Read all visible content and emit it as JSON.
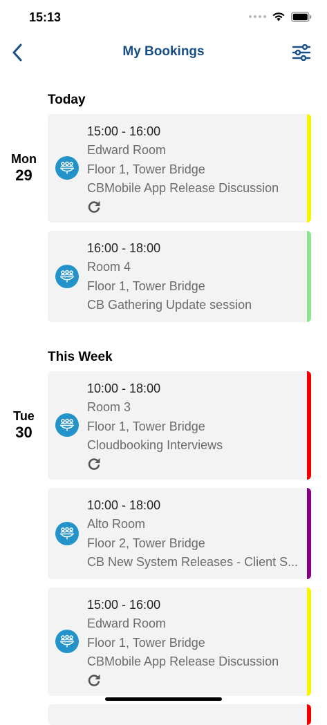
{
  "status": {
    "time": "15:13"
  },
  "nav": {
    "title": "My Bookings"
  },
  "sections": [
    {
      "title": "Today",
      "days": [
        {
          "dow": "Mon",
          "num": "29",
          "bookings": [
            {
              "time": "15:00 - 16:00",
              "room": "Edward Room",
              "location": "Floor 1, Tower Bridge",
              "title": "CBMobile App Release Discussion",
              "recurring": true,
              "color": "#f5f500"
            },
            {
              "time": "16:00 - 18:00",
              "room": "Room 4",
              "location": "Floor 1, Tower Bridge",
              "title": "CB Gathering Update session",
              "recurring": false,
              "color": "#8fe28f"
            }
          ]
        }
      ]
    },
    {
      "title": "This Week",
      "days": [
        {
          "dow": "Tue",
          "num": "30",
          "bookings": [
            {
              "time": "10:00 - 18:00",
              "room": "Room 3",
              "location": "Floor 1, Tower Bridge",
              "title": "Cloudbooking Interviews",
              "recurring": true,
              "color": "#f50000"
            },
            {
              "time": "10:00 - 18:00",
              "room": "Alto Room",
              "location": "Floor 2, Tower Bridge",
              "title": "CB New System Releases - Client S...",
              "recurring": false,
              "color": "#800080"
            },
            {
              "time": "15:00 - 16:00",
              "room": "Edward Room",
              "location": "Floor 1, Tower Bridge",
              "title": "CBMobile App Release Discussion",
              "recurring": true,
              "color": "#f5f500"
            }
          ]
        }
      ]
    }
  ],
  "icons": {
    "back": "chevron-left-icon",
    "filter": "sliders-icon",
    "room": "meeting-room-icon",
    "recurring": "repeat-icon"
  },
  "colors": {
    "accent": "#184f86",
    "room_icon_bg": "#2393c9"
  }
}
